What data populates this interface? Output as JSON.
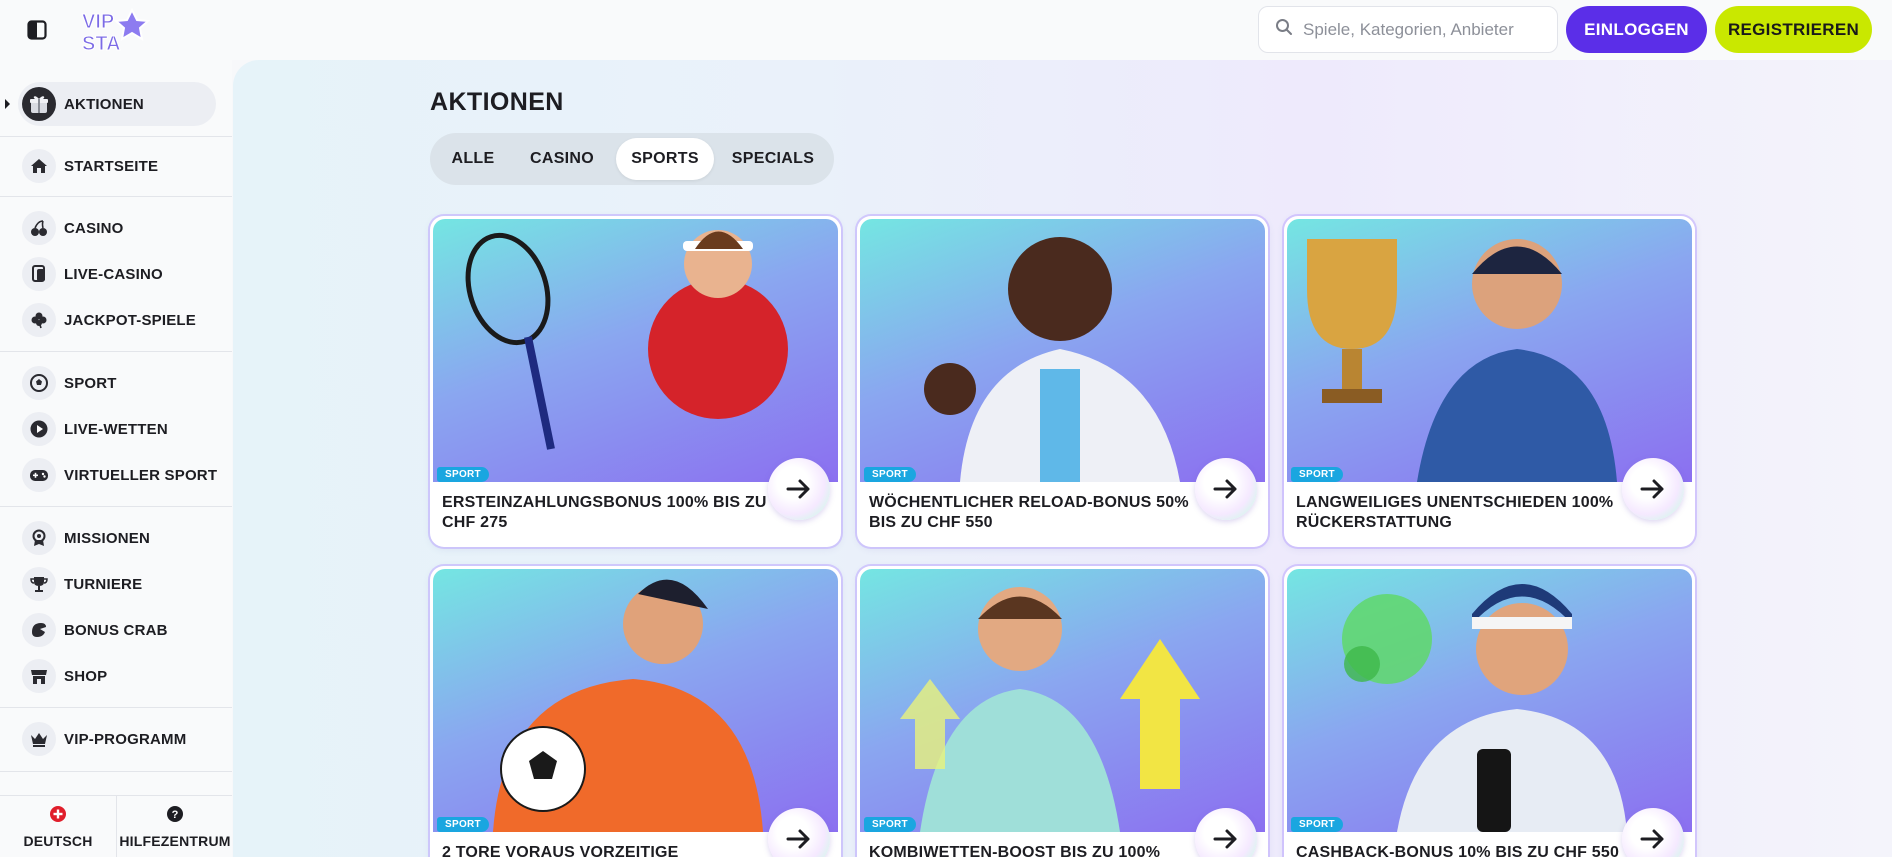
{
  "header": {
    "logo_text": "VIP STA",
    "search_placeholder": "Spiele, Kategorien, Anbieter",
    "login_label": "EINLOGGEN",
    "register_label": "REGISTRIEREN"
  },
  "sidebar": {
    "items": [
      {
        "label": "AKTIONEN",
        "icon": "gift-icon"
      },
      {
        "label": "STARTSEITE",
        "icon": "home-icon"
      },
      {
        "label": "CASINO",
        "icon": "cherries-icon"
      },
      {
        "label": "LIVE-CASINO",
        "icon": "cards-icon"
      },
      {
        "label": "JACKPOT-SPIELE",
        "icon": "clover-icon"
      },
      {
        "label": "SPORT",
        "icon": "soccer-ball-icon"
      },
      {
        "label": "LIVE-WETTEN",
        "icon": "play-icon"
      },
      {
        "label": "VIRTUELLER SPORT",
        "icon": "gamepad-icon"
      },
      {
        "label": "MISSIONEN",
        "icon": "medal-icon"
      },
      {
        "label": "TURNIERE",
        "icon": "trophy-icon"
      },
      {
        "label": "BONUS CRAB",
        "icon": "crab-claw-icon"
      },
      {
        "label": "SHOP",
        "icon": "shop-icon"
      },
      {
        "label": "VIP-PROGRAMM",
        "icon": "crown-icon"
      }
    ],
    "language_label": "DEUTSCH",
    "help_label": "HILFEZENTRUM"
  },
  "main": {
    "title": "AKTIONEN",
    "tabs": [
      {
        "label": "ALLE"
      },
      {
        "label": "CASINO"
      },
      {
        "label": "SPORTS",
        "active": true
      },
      {
        "label": "SPECIALS"
      }
    ],
    "cards": [
      {
        "badge": "SPORT",
        "title": "ERSTEINZAHLUNGSBONUS 100% BIS ZU CHF 275"
      },
      {
        "badge": "SPORT",
        "title": "WÖCHENTLICHER RELOAD-BONUS 50% BIS ZU CHF 550"
      },
      {
        "badge": "SPORT",
        "title": "LANGWEILIGES UNENTSCHIEDEN 100% RÜCKERSTATTUNG"
      },
      {
        "badge": "SPORT",
        "title": "2 TORE VORAUS VORZEITIGE"
      },
      {
        "badge": "SPORT",
        "title": "KOMBIWETTEN-BOOST BIS ZU 100%"
      },
      {
        "badge": "SPORT",
        "title": "CASHBACK-BONUS 10% BIS ZU CHF 550"
      }
    ]
  },
  "colors": {
    "primary": "#5b2ee8",
    "accent": "#c9e800",
    "badge": "#1aa6e0"
  }
}
